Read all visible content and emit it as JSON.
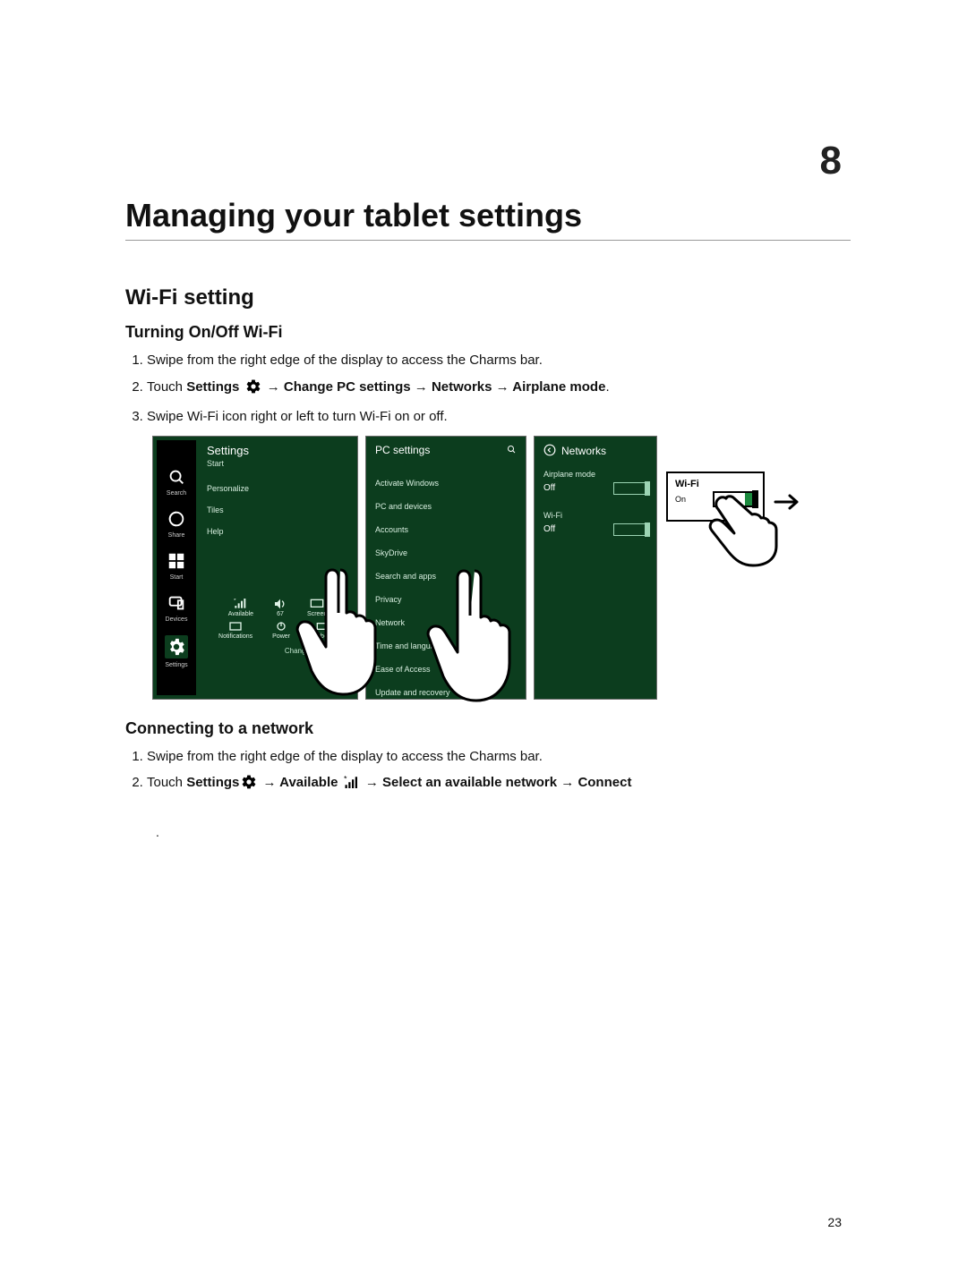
{
  "chapter_number": "8",
  "page_number": "23",
  "h1": "Managing your tablet settings",
  "h2_wifi": "Wi-Fi setting",
  "h3_turn": "Turning On/Off Wi-Fi",
  "h3_connect": "Connecting to a network",
  "turn_steps": {
    "s1": "Swipe from the right edge of the display to access the Charms bar.",
    "s2_pre": "Touch ",
    "s2_settings": "Settings",
    "s2_arrow1": " → ",
    "s2_changepc": "Change PC settings",
    "s2_arrow2": " → ",
    "s2_networks": "Networks",
    "s2_arrow3": " → ",
    "s2_airplane": "Airplane mode",
    "s2_period": ".",
    "s3": "Swipe Wi-Fi icon right or left to turn Wi-Fi on or off."
  },
  "connect_steps": {
    "s1": "Swipe from the right edge of the display to access the Charms bar.",
    "s2_pre": "Touch ",
    "s2_settings": "Settings",
    "s2_arrow1": " → ",
    "s2_available": "Available",
    "s2_arrow2": " → ",
    "s2_select": "Select an available network",
    "s2_arrow3": " → ",
    "s2_connect": "Connect"
  },
  "illustration": {
    "settings_panel": {
      "title": "Settings",
      "sub": "Start",
      "items": [
        "Personalize",
        "Tiles",
        "Help"
      ],
      "quick_actions": {
        "network": "Available",
        "volume": "67",
        "screen": "Screen",
        "notifications": "Notifications",
        "power": "Power",
        "keyboard": "Keyboard"
      },
      "change_pc": "Change PC settings"
    },
    "charms_labels": [
      "Search",
      "Share",
      "Start",
      "Devices",
      "Settings"
    ],
    "pcsettings_panel": {
      "title": "PC settings",
      "items": [
        "Activate Windows",
        "PC and devices",
        "Accounts",
        "SkyDrive",
        "Search and apps",
        "Privacy",
        "Network",
        "Time and language",
        "Ease of Access",
        "Update and recovery"
      ]
    },
    "networks_panel": {
      "title": "Networks",
      "airplane_label": "Airplane mode",
      "airplane_state": "Off",
      "wifi_label": "Wi-Fi",
      "wifi_state": "Off"
    },
    "wifi_panel": {
      "title": "Wi-Fi",
      "state": "On"
    }
  }
}
